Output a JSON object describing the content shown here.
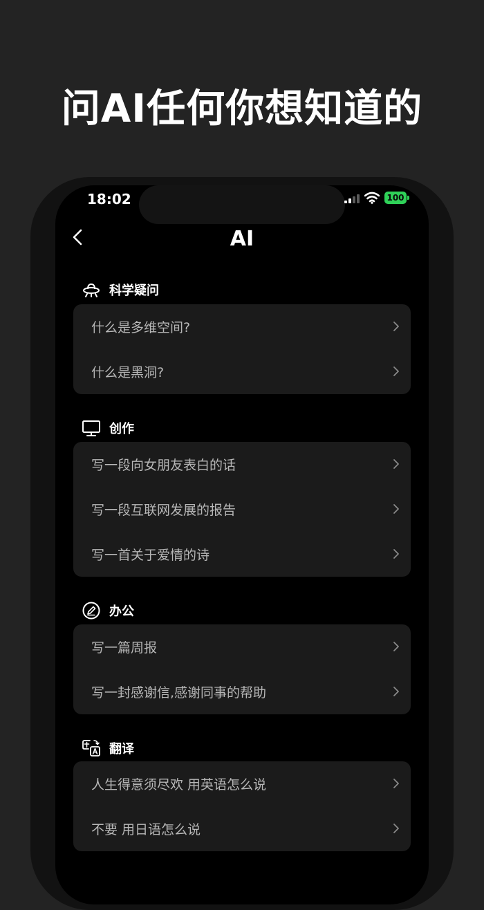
{
  "headline": "问AI任何你想知道的",
  "status_bar": {
    "time": "18:02",
    "battery": "100"
  },
  "nav": {
    "title": "AI"
  },
  "colors": {
    "background": "#232323",
    "phone_frame": "#121212",
    "screen": "#000000",
    "card": "#1b1b1b",
    "item_text": "#b7b7b7",
    "battery_green": "#2fd158"
  },
  "sections": [
    {
      "title": "科学疑问",
      "icon": "ufo-icon",
      "items": [
        "什么是多维空间?",
        "什么是黑洞?"
      ]
    },
    {
      "title": "创作",
      "icon": "monitor-icon",
      "items": [
        "写一段向女朋友表白的话",
        "写一段互联网发展的报告",
        "写一首关于爱情的诗"
      ]
    },
    {
      "title": "办公",
      "icon": "edit-circle-icon",
      "items": [
        "写一篇周报",
        "写一封感谢信,感谢同事的帮助"
      ]
    },
    {
      "title": "翻译",
      "icon": "translate-icon",
      "items": [
        "人生得意须尽欢 用英语怎么说",
        "不要 用日语怎么说"
      ]
    }
  ]
}
